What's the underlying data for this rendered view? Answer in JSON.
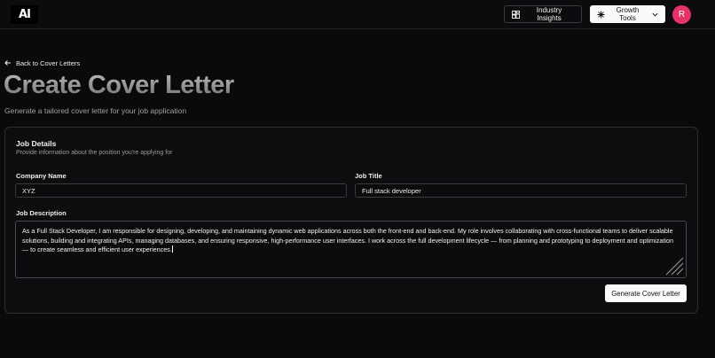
{
  "header": {
    "logo_text": "AI",
    "insights_label": "Industry Insights",
    "insights_icon": "dashboard-icon",
    "growth_label": "Growth Tools",
    "growth_icon": "sparkle-icon",
    "avatar_initial": "R",
    "avatar_color": "#e5336a"
  },
  "back_link": {
    "label": "Back to Cover Letters",
    "icon": "arrow-left-icon"
  },
  "page": {
    "title": "Create Cover Letter",
    "subtitle": "Generate a tailored cover letter for your job application"
  },
  "card": {
    "title": "Job Details",
    "description": "Provide information about the position you're applying for",
    "company_label": "Company Name",
    "company_value": "XYZ",
    "job_title_label": "Job Title",
    "job_title_value": "Full stack developer",
    "description_label": "Job Description",
    "description_value": "As a Full Stack Developer, I am responsible for designing, developing, and maintaining dynamic web applications across both the front-end and back-end. My role involves collaborating with cross-functional teams to deliver scalable solutions, building and integrating APIs, managing databases, and ensuring responsive, high-performance user interfaces. I work across the full development lifecycle — from planning and prototyping to deployment and optimization — to create seamless and efficient user experiences.",
    "generate_label": "Generate Cover Letter"
  }
}
